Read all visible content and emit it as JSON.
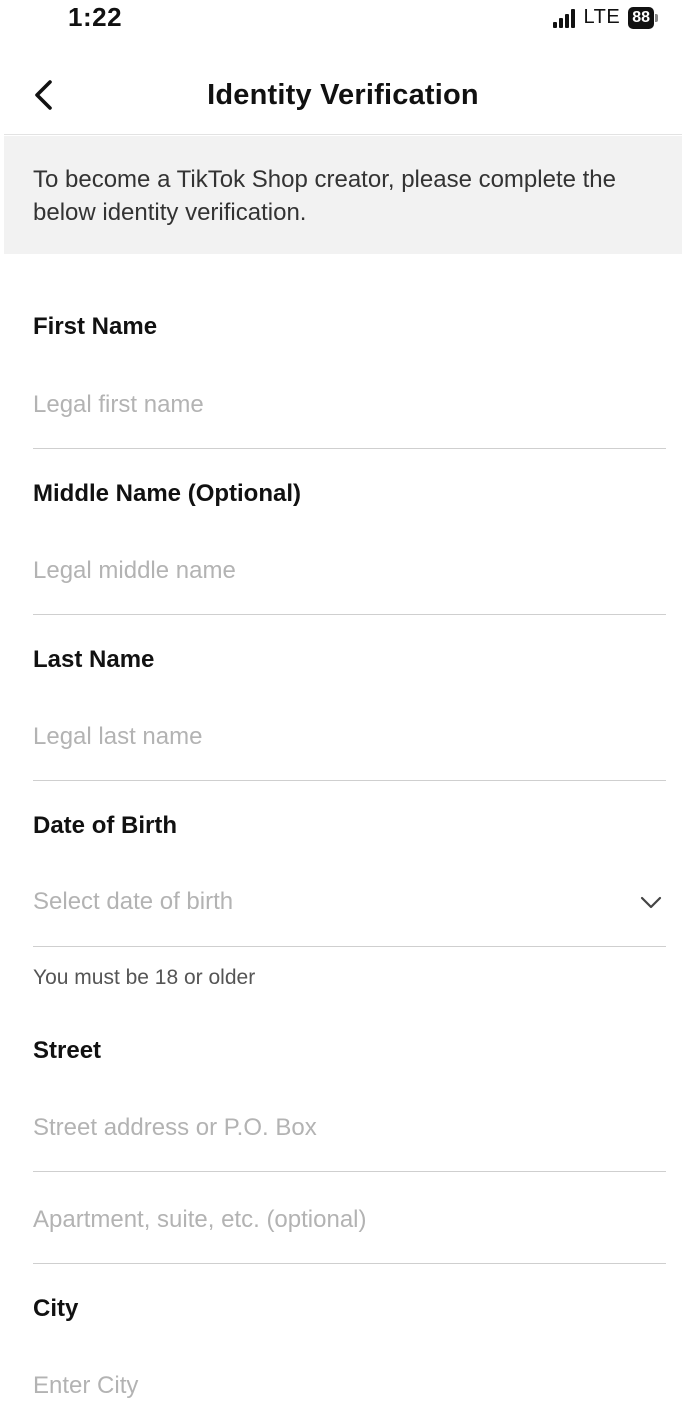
{
  "status_bar": {
    "time": "1:22",
    "network": "LTE",
    "battery": "88"
  },
  "nav": {
    "title": "Identity Verification",
    "back_icon": "chevron-left-icon"
  },
  "notice": {
    "text": "To become a TikTok Shop creator, please complete the below identity verification."
  },
  "form": {
    "first_name": {
      "label": "First Name",
      "placeholder": "Legal first name",
      "value": ""
    },
    "middle_name": {
      "label": "Middle Name (Optional)",
      "placeholder": "Legal middle name",
      "value": ""
    },
    "last_name": {
      "label": "Last Name",
      "placeholder": "Legal last name",
      "value": ""
    },
    "date_of_birth": {
      "label": "Date of Birth",
      "placeholder": "Select date of birth",
      "helper": "You must be 18 or older",
      "icon": "chevron-down-icon"
    },
    "street": {
      "label": "Street",
      "placeholder": "Street address or P.O. Box",
      "value": ""
    },
    "apartment": {
      "placeholder": "Apartment, suite, etc. (optional)",
      "value": ""
    },
    "city": {
      "label": "City",
      "placeholder": "Enter City",
      "value": ""
    }
  },
  "colors": {
    "text_primary": "#111111",
    "placeholder": "#b3b3b3",
    "banner_background": "#f2f2f2",
    "divider": "#cfcfcf"
  }
}
